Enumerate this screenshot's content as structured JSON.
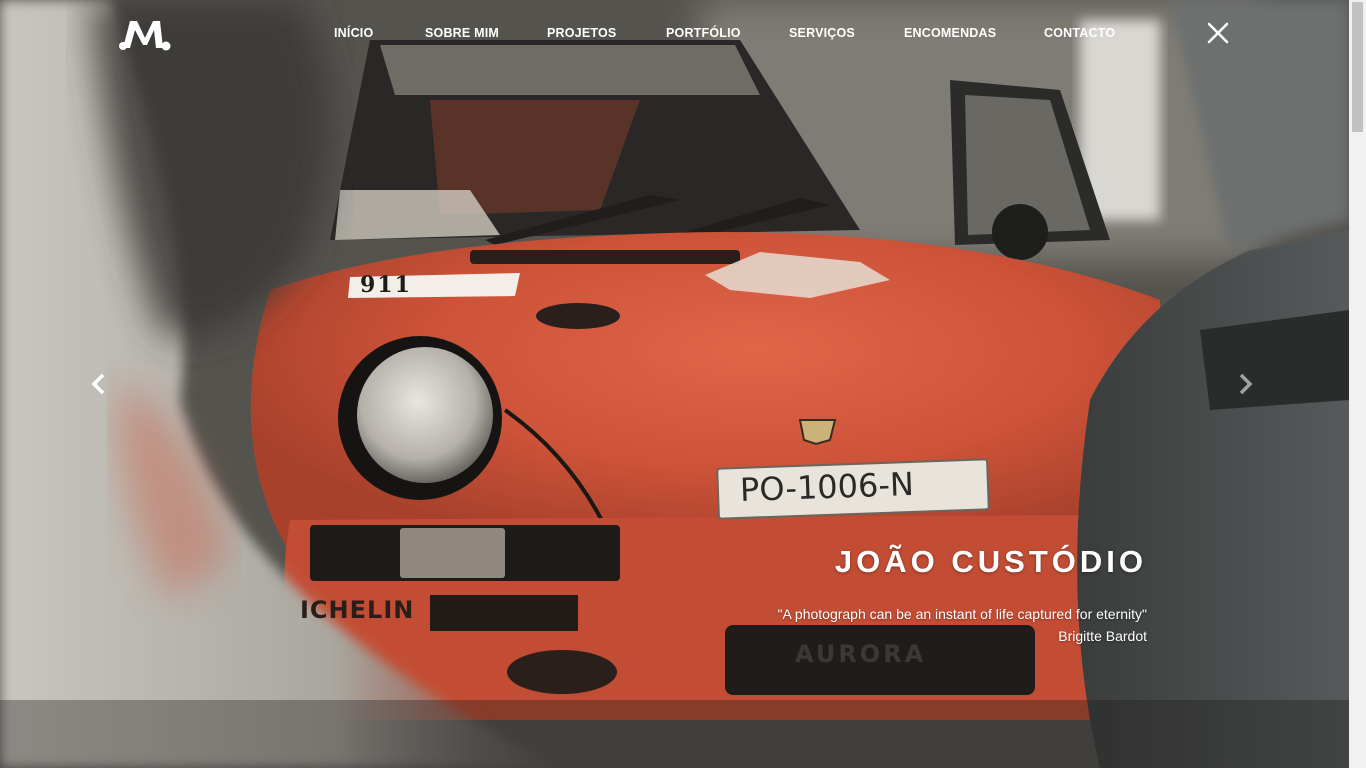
{
  "brand": {
    "logo_text": "M."
  },
  "nav": {
    "items": [
      {
        "label": "INÍCIO"
      },
      {
        "label": "SOBRE MIM"
      },
      {
        "label": "PROJETOS"
      },
      {
        "label": "PORTFÓLIO"
      },
      {
        "label": "SERVIÇOS"
      },
      {
        "label": "ENCOMENDAS"
      },
      {
        "label": "CONTACTO"
      }
    ],
    "close_icon": "close-icon"
  },
  "hero": {
    "plate_text": "PO-1006-N",
    "hood_number": "911",
    "bumper_text": "AURORA",
    "tyre_brand": "ICHELIN",
    "prev_icon": "chevron-left-icon",
    "next_icon": "chevron-right-icon",
    "accent_color": "#d2553a"
  },
  "caption": {
    "name": "JOÃO CUSTÓDIO",
    "quote": "\"A photograph can be an instant of life captured for eternity\"",
    "author": "Brigitte Bardot"
  }
}
